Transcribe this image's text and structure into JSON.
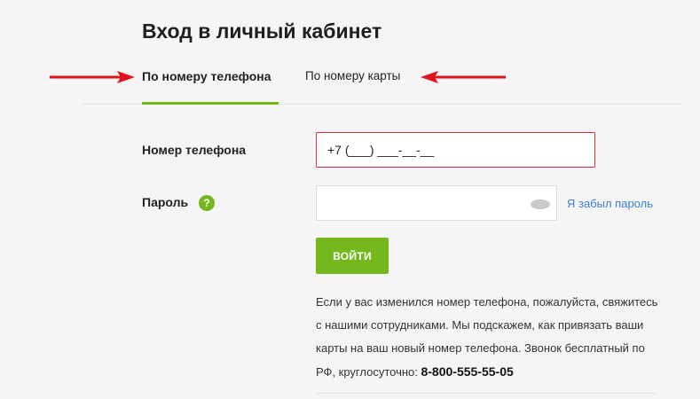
{
  "page": {
    "title": "Вход в личный кабинет"
  },
  "tabs": [
    {
      "label": "По номеру телефона",
      "active": true
    },
    {
      "label": "По номеру карты",
      "active": false
    }
  ],
  "form": {
    "phone_label": "Номер телефона",
    "phone_value": "+7 (___) ___-__-__",
    "password_label": "Пароль",
    "help_icon": "?",
    "password_value": "",
    "forgot_link": "Я забыл пароль",
    "submit_label": "ВОЙТИ"
  },
  "info": {
    "text": "Если у вас изменился номер телефона, пожалуйста, свяжитесь с нашими сотрудниками. Мы подскажем, как привязать ваши карты на ваш новый номер телефона. Звонок бесплатный по РФ, круглосуточно: ",
    "hotline": "8-800-555-55-05"
  },
  "colors": {
    "accent": "#74b81e",
    "error_border": "#d9303a",
    "link": "#3d7ed8",
    "annotation_arrow": "#e0141e"
  },
  "icons": {
    "help": "question-circle-icon",
    "password_toggle": "eye-icon",
    "annotation": "red-arrow-icon"
  }
}
